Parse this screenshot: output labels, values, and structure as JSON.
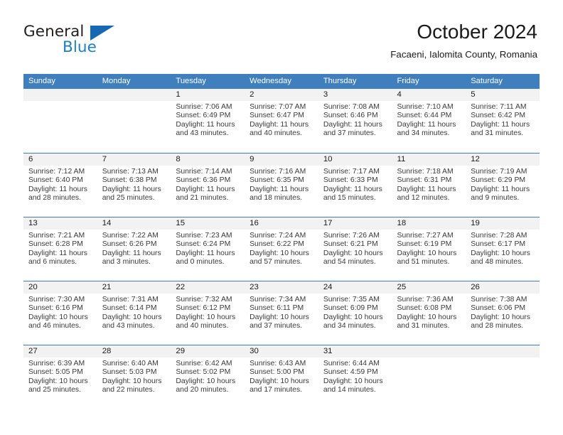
{
  "brand": {
    "name_top": "General",
    "name_bottom": "Blue",
    "accent_color": "#1668b3",
    "blue_text_color": "#1f7fc4"
  },
  "header": {
    "title": "October 2024",
    "subtitle": "Facaeni, Ialomita County, Romania"
  },
  "theme": {
    "header_blue": "#3f7fbe",
    "date_strip_gray": "#f2f2f2",
    "text_color": "#1a1a1a"
  },
  "weekdays": [
    "Sunday",
    "Monday",
    "Tuesday",
    "Wednesday",
    "Thursday",
    "Friday",
    "Saturday"
  ],
  "weeks": [
    [
      {
        "day": "",
        "empty": true,
        "sunrise": "",
        "sunset": "",
        "daylight1": "",
        "daylight2": ""
      },
      {
        "day": "",
        "empty": true,
        "sunrise": "",
        "sunset": "",
        "daylight1": "",
        "daylight2": ""
      },
      {
        "day": "1",
        "empty": false,
        "sunrise": "Sunrise: 7:06 AM",
        "sunset": "Sunset: 6:49 PM",
        "daylight1": "Daylight: 11 hours",
        "daylight2": "and 43 minutes."
      },
      {
        "day": "2",
        "empty": false,
        "sunrise": "Sunrise: 7:07 AM",
        "sunset": "Sunset: 6:47 PM",
        "daylight1": "Daylight: 11 hours",
        "daylight2": "and 40 minutes."
      },
      {
        "day": "3",
        "empty": false,
        "sunrise": "Sunrise: 7:08 AM",
        "sunset": "Sunset: 6:46 PM",
        "daylight1": "Daylight: 11 hours",
        "daylight2": "and 37 minutes."
      },
      {
        "day": "4",
        "empty": false,
        "sunrise": "Sunrise: 7:10 AM",
        "sunset": "Sunset: 6:44 PM",
        "daylight1": "Daylight: 11 hours",
        "daylight2": "and 34 minutes."
      },
      {
        "day": "5",
        "empty": false,
        "sunrise": "Sunrise: 7:11 AM",
        "sunset": "Sunset: 6:42 PM",
        "daylight1": "Daylight: 11 hours",
        "daylight2": "and 31 minutes."
      }
    ],
    [
      {
        "day": "6",
        "empty": false,
        "sunrise": "Sunrise: 7:12 AM",
        "sunset": "Sunset: 6:40 PM",
        "daylight1": "Daylight: 11 hours",
        "daylight2": "and 28 minutes."
      },
      {
        "day": "7",
        "empty": false,
        "sunrise": "Sunrise: 7:13 AM",
        "sunset": "Sunset: 6:38 PM",
        "daylight1": "Daylight: 11 hours",
        "daylight2": "and 25 minutes."
      },
      {
        "day": "8",
        "empty": false,
        "sunrise": "Sunrise: 7:14 AM",
        "sunset": "Sunset: 6:36 PM",
        "daylight1": "Daylight: 11 hours",
        "daylight2": "and 21 minutes."
      },
      {
        "day": "9",
        "empty": false,
        "sunrise": "Sunrise: 7:16 AM",
        "sunset": "Sunset: 6:35 PM",
        "daylight1": "Daylight: 11 hours",
        "daylight2": "and 18 minutes."
      },
      {
        "day": "10",
        "empty": false,
        "sunrise": "Sunrise: 7:17 AM",
        "sunset": "Sunset: 6:33 PM",
        "daylight1": "Daylight: 11 hours",
        "daylight2": "and 15 minutes."
      },
      {
        "day": "11",
        "empty": false,
        "sunrise": "Sunrise: 7:18 AM",
        "sunset": "Sunset: 6:31 PM",
        "daylight1": "Daylight: 11 hours",
        "daylight2": "and 12 minutes."
      },
      {
        "day": "12",
        "empty": false,
        "sunrise": "Sunrise: 7:19 AM",
        "sunset": "Sunset: 6:29 PM",
        "daylight1": "Daylight: 11 hours",
        "daylight2": "and 9 minutes."
      }
    ],
    [
      {
        "day": "13",
        "empty": false,
        "sunrise": "Sunrise: 7:21 AM",
        "sunset": "Sunset: 6:28 PM",
        "daylight1": "Daylight: 11 hours",
        "daylight2": "and 6 minutes."
      },
      {
        "day": "14",
        "empty": false,
        "sunrise": "Sunrise: 7:22 AM",
        "sunset": "Sunset: 6:26 PM",
        "daylight1": "Daylight: 11 hours",
        "daylight2": "and 3 minutes."
      },
      {
        "day": "15",
        "empty": false,
        "sunrise": "Sunrise: 7:23 AM",
        "sunset": "Sunset: 6:24 PM",
        "daylight1": "Daylight: 11 hours",
        "daylight2": "and 0 minutes."
      },
      {
        "day": "16",
        "empty": false,
        "sunrise": "Sunrise: 7:24 AM",
        "sunset": "Sunset: 6:22 PM",
        "daylight1": "Daylight: 10 hours",
        "daylight2": "and 57 minutes."
      },
      {
        "day": "17",
        "empty": false,
        "sunrise": "Sunrise: 7:26 AM",
        "sunset": "Sunset: 6:21 PM",
        "daylight1": "Daylight: 10 hours",
        "daylight2": "and 54 minutes."
      },
      {
        "day": "18",
        "empty": false,
        "sunrise": "Sunrise: 7:27 AM",
        "sunset": "Sunset: 6:19 PM",
        "daylight1": "Daylight: 10 hours",
        "daylight2": "and 51 minutes."
      },
      {
        "day": "19",
        "empty": false,
        "sunrise": "Sunrise: 7:28 AM",
        "sunset": "Sunset: 6:17 PM",
        "daylight1": "Daylight: 10 hours",
        "daylight2": "and 48 minutes."
      }
    ],
    [
      {
        "day": "20",
        "empty": false,
        "sunrise": "Sunrise: 7:30 AM",
        "sunset": "Sunset: 6:16 PM",
        "daylight1": "Daylight: 10 hours",
        "daylight2": "and 46 minutes."
      },
      {
        "day": "21",
        "empty": false,
        "sunrise": "Sunrise: 7:31 AM",
        "sunset": "Sunset: 6:14 PM",
        "daylight1": "Daylight: 10 hours",
        "daylight2": "and 43 minutes."
      },
      {
        "day": "22",
        "empty": false,
        "sunrise": "Sunrise: 7:32 AM",
        "sunset": "Sunset: 6:12 PM",
        "daylight1": "Daylight: 10 hours",
        "daylight2": "and 40 minutes."
      },
      {
        "day": "23",
        "empty": false,
        "sunrise": "Sunrise: 7:34 AM",
        "sunset": "Sunset: 6:11 PM",
        "daylight1": "Daylight: 10 hours",
        "daylight2": "and 37 minutes."
      },
      {
        "day": "24",
        "empty": false,
        "sunrise": "Sunrise: 7:35 AM",
        "sunset": "Sunset: 6:09 PM",
        "daylight1": "Daylight: 10 hours",
        "daylight2": "and 34 minutes."
      },
      {
        "day": "25",
        "empty": false,
        "sunrise": "Sunrise: 7:36 AM",
        "sunset": "Sunset: 6:08 PM",
        "daylight1": "Daylight: 10 hours",
        "daylight2": "and 31 minutes."
      },
      {
        "day": "26",
        "empty": false,
        "sunrise": "Sunrise: 7:38 AM",
        "sunset": "Sunset: 6:06 PM",
        "daylight1": "Daylight: 10 hours",
        "daylight2": "and 28 minutes."
      }
    ],
    [
      {
        "day": "27",
        "empty": false,
        "sunrise": "Sunrise: 6:39 AM",
        "sunset": "Sunset: 5:05 PM",
        "daylight1": "Daylight: 10 hours",
        "daylight2": "and 25 minutes."
      },
      {
        "day": "28",
        "empty": false,
        "sunrise": "Sunrise: 6:40 AM",
        "sunset": "Sunset: 5:03 PM",
        "daylight1": "Daylight: 10 hours",
        "daylight2": "and 22 minutes."
      },
      {
        "day": "29",
        "empty": false,
        "sunrise": "Sunrise: 6:42 AM",
        "sunset": "Sunset: 5:02 PM",
        "daylight1": "Daylight: 10 hours",
        "daylight2": "and 20 minutes."
      },
      {
        "day": "30",
        "empty": false,
        "sunrise": "Sunrise: 6:43 AM",
        "sunset": "Sunset: 5:00 PM",
        "daylight1": "Daylight: 10 hours",
        "daylight2": "and 17 minutes."
      },
      {
        "day": "31",
        "empty": false,
        "sunrise": "Sunrise: 6:44 AM",
        "sunset": "Sunset: 4:59 PM",
        "daylight1": "Daylight: 10 hours",
        "daylight2": "and 14 minutes."
      },
      {
        "day": "",
        "empty": true,
        "sunrise": "",
        "sunset": "",
        "daylight1": "",
        "daylight2": ""
      },
      {
        "day": "",
        "empty": true,
        "sunrise": "",
        "sunset": "",
        "daylight1": "",
        "daylight2": ""
      }
    ]
  ]
}
